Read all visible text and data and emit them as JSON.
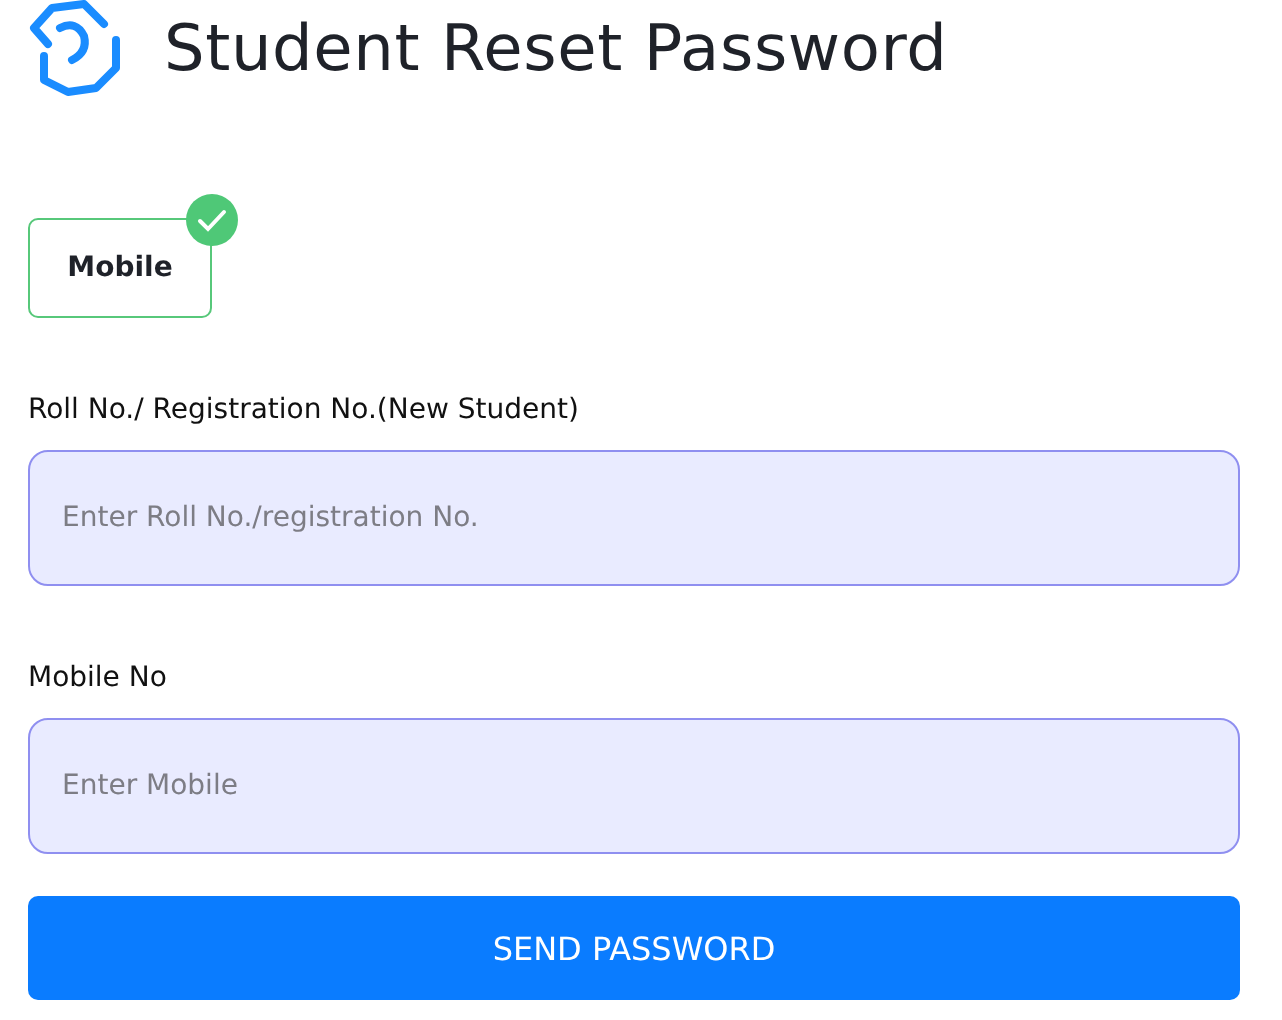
{
  "title": "Student Reset Password",
  "options": [
    {
      "label": "Mobile",
      "selected": true
    }
  ],
  "fields": [
    {
      "label": "Roll No./ Registration No.(New Student)",
      "placeholder": "Enter Roll No./registration No."
    },
    {
      "label": "Mobile No",
      "placeholder": "Enter Mobile"
    }
  ],
  "submit": "SEND PASSWORD"
}
